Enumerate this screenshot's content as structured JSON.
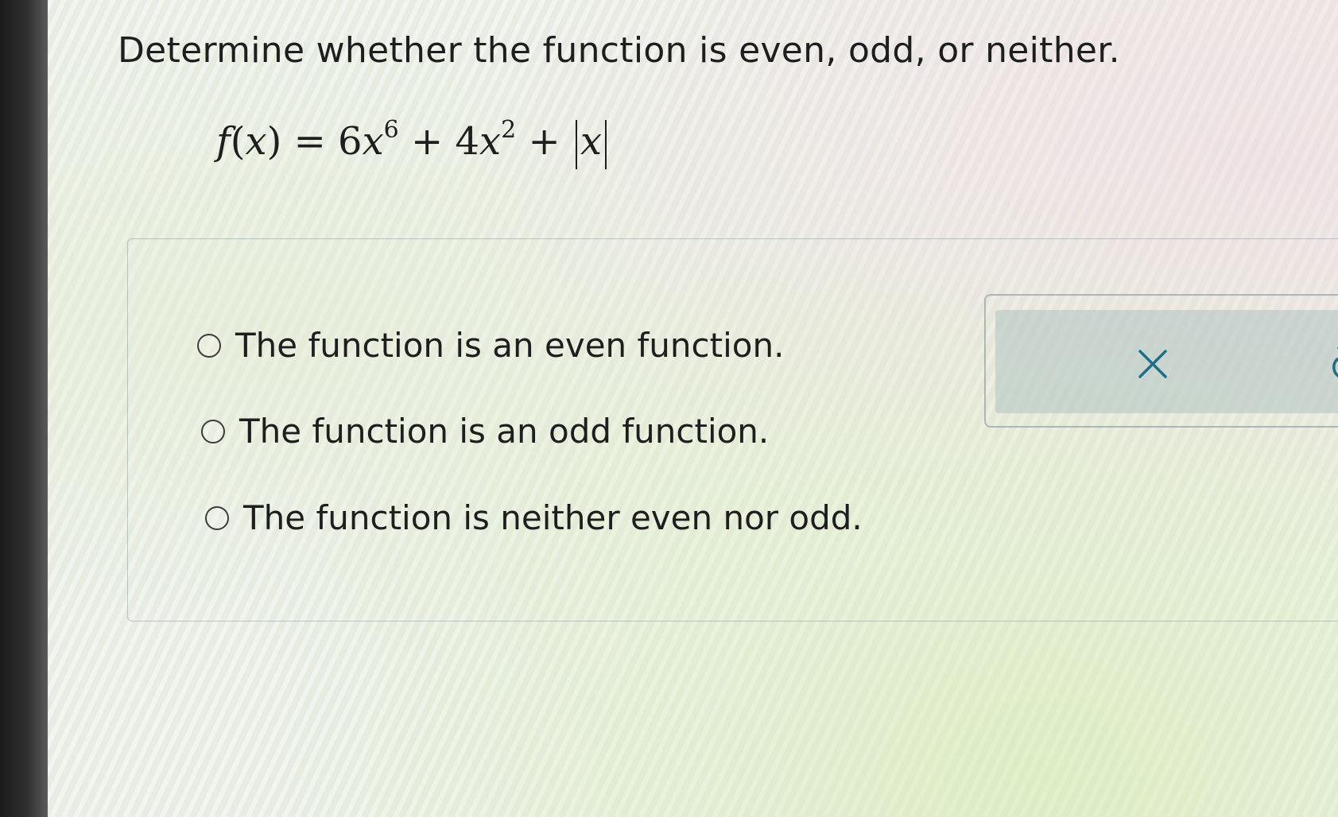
{
  "question": {
    "prompt": "Determine whether the function is even, odd, or neither."
  },
  "formula": {
    "lhs_f": "f",
    "lhs_open": "(",
    "lhs_var": "x",
    "lhs_close": ")",
    "equals": " = ",
    "term1_coef": "6",
    "term1_var": "x",
    "term1_exp": "6",
    "plus1": " + ",
    "term2_coef": "4",
    "term2_var": "x",
    "term2_exp": "2",
    "plus2": " + ",
    "abs_var": "x"
  },
  "options": [
    {
      "label": "The function is an even function.",
      "selected": false
    },
    {
      "label": "The function is an odd function.",
      "selected": false
    },
    {
      "label": "The function is neither even nor odd.",
      "selected": false
    }
  ],
  "tools": {
    "clear_icon": "close-x-icon",
    "undo_icon": "undo-arrow-icon",
    "icon_color": "#1f6f8b"
  }
}
